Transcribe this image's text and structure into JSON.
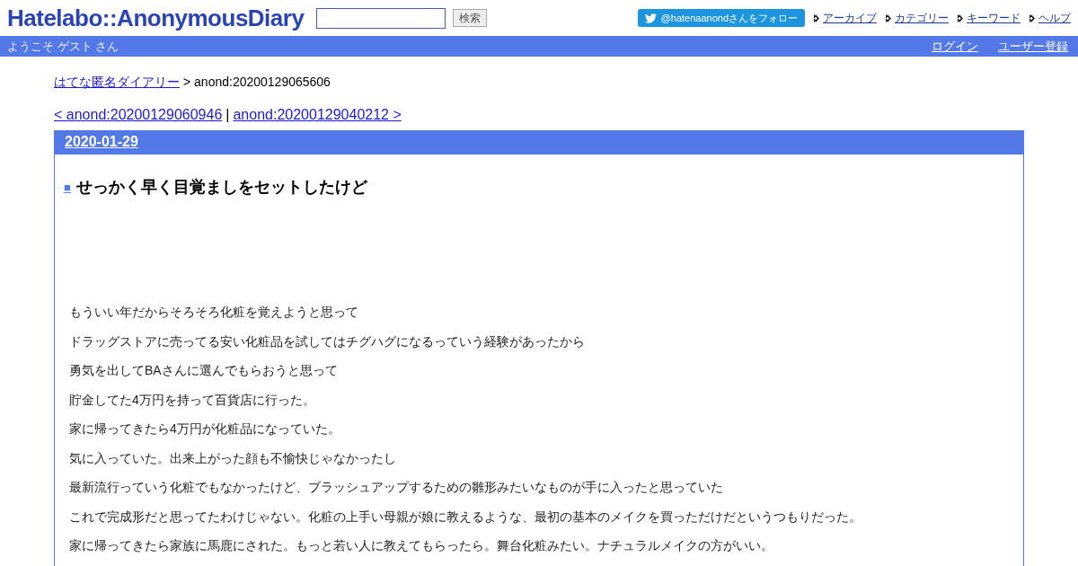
{
  "header": {
    "logo": "Hatelabo::AnonymousDiary",
    "search": {
      "button": "検索"
    },
    "follow_button": "@hatenaanondさんをフォロー",
    "nav_links": [
      "アーカイブ",
      "カテゴリー",
      "キーワード",
      "ヘルプ"
    ]
  },
  "welcome_bar": {
    "greeting": "ようこそ ゲスト さん",
    "links": [
      "ログイン",
      "ユーザー登録"
    ]
  },
  "breadcrumb": {
    "link": "はてな匿名ダイアリー",
    "current": "> anond:20200129065606"
  },
  "pager": {
    "prev": "< anond:20200129060946",
    "separator": "|",
    "next": "anond:20200129040212 >"
  },
  "entry": {
    "date": "2020-01-29",
    "title_mark": "■",
    "title": "せっかく早く目覚ましをセットしたけど",
    "paragraphs": [
      "もういい年だからそろそろ化粧を覚えようと思って",
      "ドラッグストアに売ってる安い化粧品を試してはチグハグになるっていう経験があったから",
      "勇気を出してBAさんに選んでもらおうと思って",
      "貯金してた4万円を持って百貨店に行った。",
      "家に帰ってきたら4万円が化粧品になっていた。",
      "気に入っていた。出来上がった顔も不愉快じゃなかったし",
      "最新流行っていう化粧でもなかったけど、ブラッシュアップするための雛形みたいなものが手に入ったと思っていた",
      "これで完成形だと思ってたわけじゃない。化粧の上手い母親が娘に教えるような、最初の基本のメイクを買っただけだというつもりだった。",
      "家に帰ってきたら家族に馬鹿にされた。もっと若い人に教えてもらったら。舞台化粧みたい。ナチュラルメイクの方がいい。"
    ]
  }
}
